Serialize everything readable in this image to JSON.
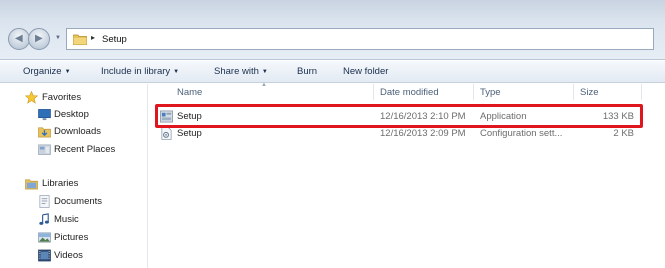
{
  "address": {
    "breadcrumb": "Setup"
  },
  "toolbar": {
    "organize": "Organize",
    "include_in_library": "Include in library",
    "share_with": "Share with",
    "burn": "Burn",
    "new_folder": "New folder"
  },
  "sidebar": {
    "items": [
      {
        "label": "Favorites",
        "icon": "star-icon"
      },
      {
        "label": "Desktop",
        "icon": "desktop-icon"
      },
      {
        "label": "Downloads",
        "icon": "downloads-icon"
      },
      {
        "label": "Recent Places",
        "icon": "recent-places-icon"
      },
      {
        "label": "Libraries",
        "icon": "libraries-icon"
      },
      {
        "label": "Documents",
        "icon": "documents-icon"
      },
      {
        "label": "Music",
        "icon": "music-icon"
      },
      {
        "label": "Pictures",
        "icon": "pictures-icon"
      },
      {
        "label": "Videos",
        "icon": "videos-icon"
      }
    ]
  },
  "columns": {
    "name": "Name",
    "date": "Date modified",
    "type": "Type",
    "size": "Size"
  },
  "files": [
    {
      "name": "Setup",
      "date": "12/16/2013 2:10 PM",
      "type": "Application",
      "size": "133 KB",
      "icon": "application-icon"
    },
    {
      "name": "Setup",
      "date": "12/16/2013 2:09 PM",
      "type": "Configuration sett...",
      "size": "2 KB",
      "icon": "config-file-icon"
    }
  ],
  "colors": {
    "highlight": "#e0161f"
  }
}
